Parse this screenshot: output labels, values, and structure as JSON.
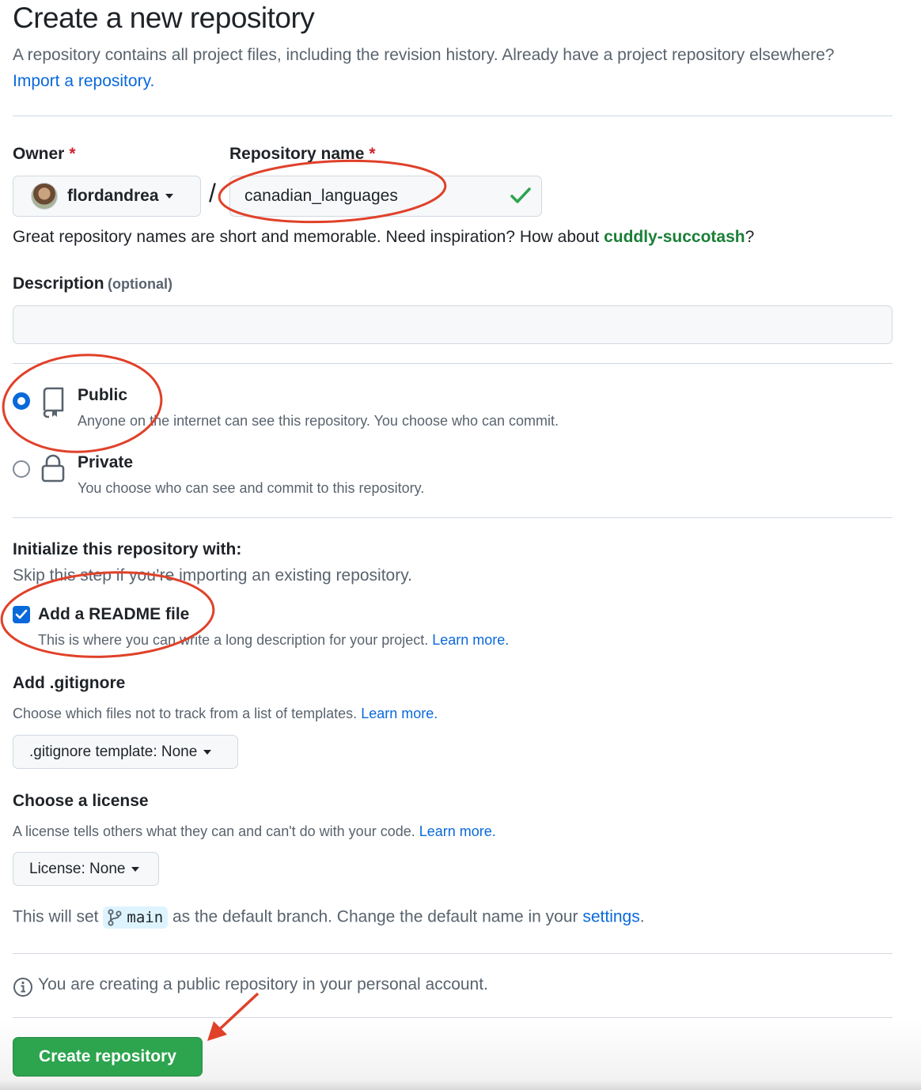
{
  "header": {
    "title": "Create a new repository",
    "lead_text": "A repository contains all project files, including the revision history. Already have a project repository elsewhere?",
    "import_link": "Import a repository."
  },
  "owner": {
    "label": "Owner",
    "required_mark": "*",
    "value": "flordandrea"
  },
  "repo_name": {
    "label": "Repository name",
    "required_mark": "*",
    "separator": "/",
    "value": "canadian_languages",
    "hint_prefix": "Great repository names are short and memorable. Need inspiration? How about",
    "suggestion": "cuddly-succotash",
    "hint_suffix": "?"
  },
  "description": {
    "label": "Description",
    "optional": "(optional)",
    "value": ""
  },
  "visibility": {
    "selected": "public",
    "options": [
      {
        "title": "Public",
        "subtitle": "Anyone on the internet can see this repository. You choose who can commit.",
        "icon": "repo-icon"
      },
      {
        "title": "Private",
        "subtitle": "You choose who can see and commit to this repository.",
        "icon": "lock-icon"
      }
    ]
  },
  "initialize": {
    "title": "Initialize this repository with:",
    "subtitle": "Skip this step if you’re importing an existing repository.",
    "readme": {
      "checked": true,
      "label": "Add a README file",
      "description": "This is where you can write a long description for your project.",
      "learn_more": "Learn more."
    }
  },
  "gitignore": {
    "title": "Add .gitignore",
    "description": "Choose which files not to track from a list of templates.",
    "learn_more": "Learn more.",
    "button": ".gitignore template: None"
  },
  "license": {
    "title": "Choose a license",
    "description": "A license tells others what they can and can't do with your code.",
    "learn_more": "Learn more.",
    "button": "License: None"
  },
  "branch": {
    "prefix": "This will set",
    "name": "main",
    "middle": "as the default branch. Change the default name in your",
    "settings_link": "settings",
    "suffix": "."
  },
  "notice": {
    "text": "You are creating a public repository in your personal account."
  },
  "submit": {
    "label": "Create repository"
  },
  "colors": {
    "link": "#0969da",
    "success": "#1a7f37",
    "primary_button": "#2da44e",
    "annotation": "#e0412a"
  }
}
